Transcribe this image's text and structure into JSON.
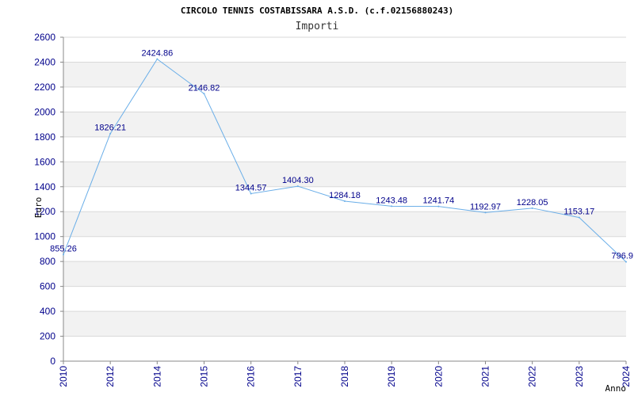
{
  "title": "CIRCOLO TENNIS COSTABISSARA A.S.D. (c.f.02156880243)",
  "chart_data": {
    "type": "line",
    "title": "CIRCOLO TENNIS COSTABISSARA A.S.D. (c.f.02156880243)",
    "subtitle": "Importi",
    "xlabel": "Anno",
    "ylabel": "Euro",
    "ylim": [
      0,
      2600
    ],
    "yticks": [
      "0",
      "200",
      "400",
      "600",
      "800",
      "1000",
      "1200",
      "1400",
      "1600",
      "1800",
      "2000",
      "2200",
      "2400",
      "2600"
    ],
    "grid": true,
    "categories": [
      "2010",
      "2012",
      "2014",
      "2015",
      "2016",
      "2017",
      "2018",
      "2019",
      "2020",
      "2021",
      "2022",
      "2023",
      "2024"
    ],
    "values": [
      855.26,
      1826.21,
      2424.86,
      2146.82,
      1344.57,
      1404.3,
      1284.18,
      1243.48,
      1241.74,
      1192.97,
      1228.05,
      1153.17,
      796.9
    ],
    "data_labels": [
      "855.26",
      "1826.21",
      "2424.86",
      "2146.82",
      "1344.57",
      "1404.30",
      "1284.18",
      "1243.48",
      "1241.74",
      "1192.97",
      "1228.05",
      "1153.17",
      "796.9"
    ],
    "colors": {
      "line": "#6aaee8",
      "band": "#f2f2f2",
      "grid": "#d9d9d9",
      "text": "#00008b"
    }
  }
}
